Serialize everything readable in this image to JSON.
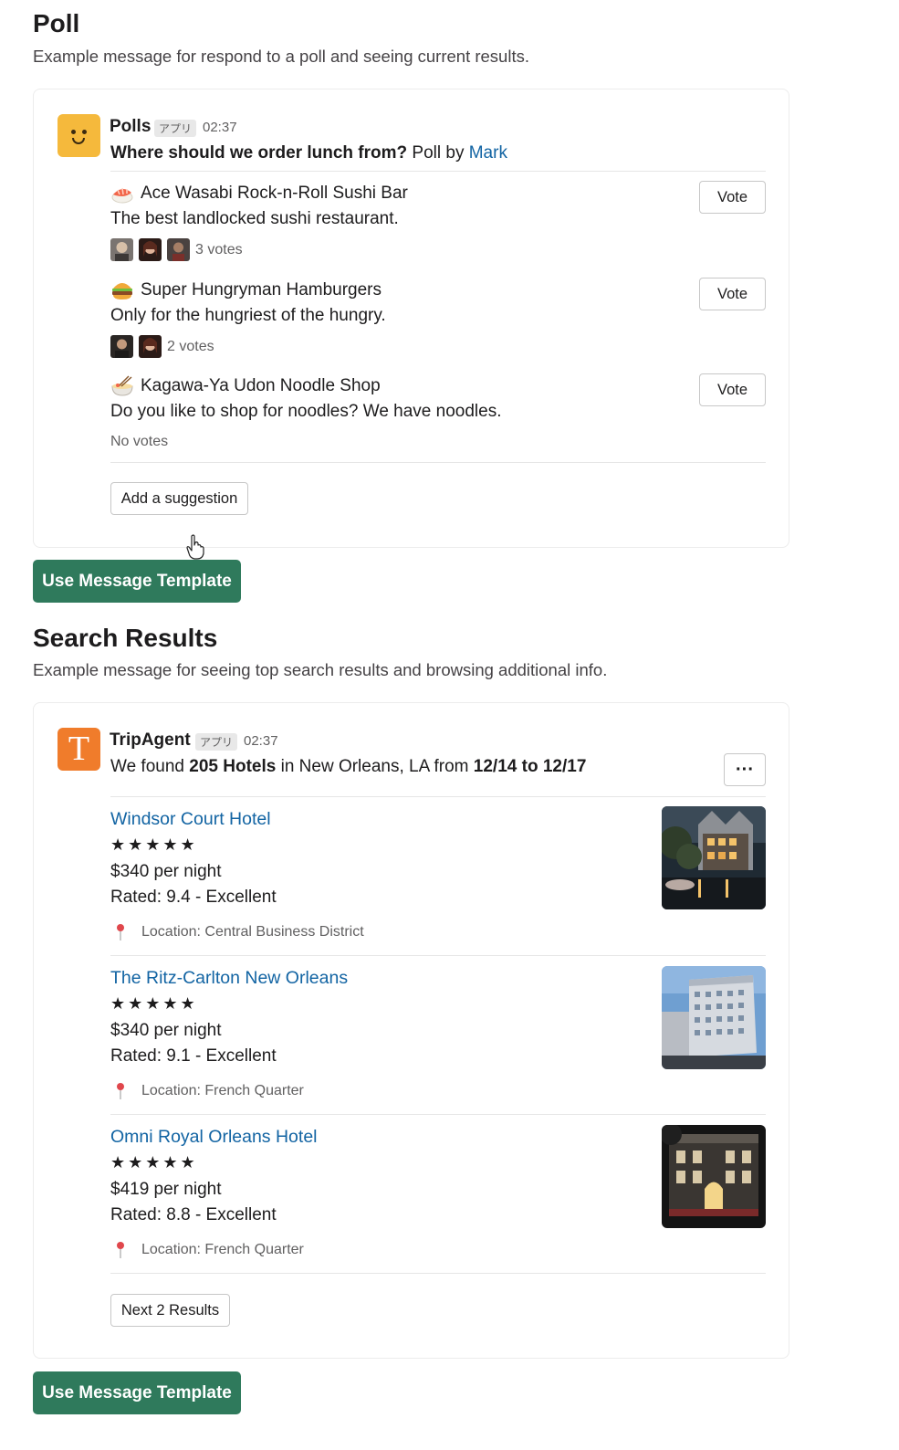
{
  "poll_section": {
    "title": "Poll",
    "description": "Example message for respond to a poll and seeing current results.",
    "message": {
      "sender": "Polls",
      "app_badge": "アプリ",
      "time": "02:37",
      "question": "Where should we order lunch from?",
      "poll_by": "Poll by",
      "author": "Mark",
      "options": [
        {
          "emoji": "sushi-icon",
          "name": "Ace Wasabi Rock-n-Roll Sushi Bar",
          "description": "The best landlocked sushi restaurant.",
          "votes": "3 votes",
          "vote_label": "Vote"
        },
        {
          "emoji": "hamburger-icon",
          "name": "Super Hungryman Hamburgers",
          "description": "Only for the hungriest of the hungry.",
          "votes": "2 votes",
          "vote_label": "Vote"
        },
        {
          "emoji": "noodle-icon",
          "name": "Kagawa-Ya Udon Noodle Shop",
          "description": "Do you like to shop for noodles? We have noodles.",
          "votes": "No votes",
          "vote_label": "Vote"
        }
      ],
      "suggestion_label": "Add a suggestion"
    },
    "template_button": "Use Message Template"
  },
  "search_section": {
    "title": "Search Results",
    "description": "Example message for seeing top search results and browsing additional info.",
    "message": {
      "sender": "TripAgent",
      "avatar_letter": "T",
      "app_badge": "アプリ",
      "time": "02:37",
      "summary_prefix": "We found",
      "summary_count": "205 Hotels",
      "summary_mid": "in New Orleans, LA from",
      "summary_dates": "12/14 to 12/17",
      "more_label": "···",
      "hotels": [
        {
          "name": "Windsor Court Hotel",
          "stars": "★★★★★",
          "price": "$340 per night",
          "rating": "Rated: 9.4 - Excellent",
          "location": "Location: Central Business District"
        },
        {
          "name": "The Ritz-Carlton New Orleans",
          "stars": "★★★★★",
          "price": "$340 per night",
          "rating": "Rated: 9.1 - Excellent",
          "location": "Location: French Quarter"
        },
        {
          "name": "Omni Royal Orleans Hotel",
          "stars": "★★★★★",
          "price": "$419 per night",
          "rating": "Rated: 8.8 - Excellent",
          "location": "Location: French Quarter"
        }
      ],
      "next_label": "Next 2 Results"
    },
    "template_button": "Use Message Template"
  },
  "colors": {
    "link": "#1264a3",
    "primary_button": "#2f7a5c",
    "polls_avatar": "#f5b93c",
    "trip_avatar": "#f07c2b"
  }
}
